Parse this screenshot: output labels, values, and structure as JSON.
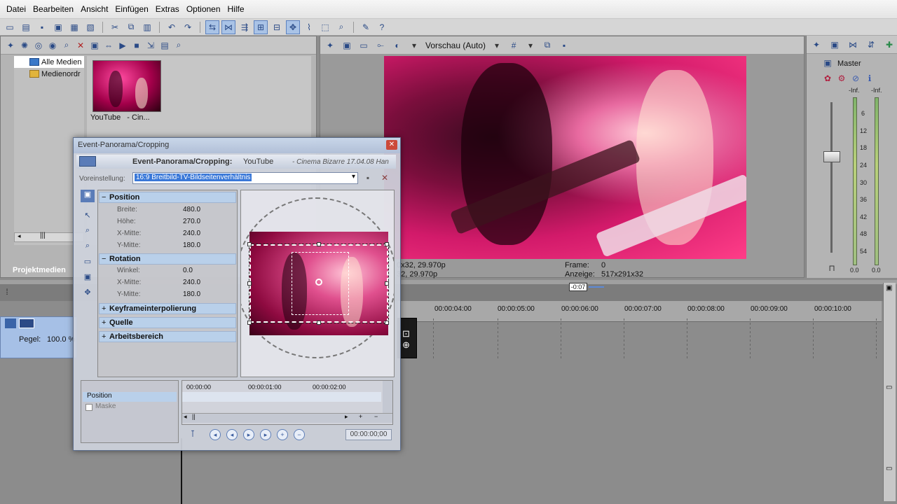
{
  "menubar": [
    "Datei",
    "Bearbeiten",
    "Ansicht",
    "Einfügen",
    "Extras",
    "Optionen",
    "Hilfe"
  ],
  "media": {
    "tree": [
      "Alle Medien",
      "Medienordr"
    ],
    "thumb_label": "YouTube",
    "thumb_sub": "- Cin...",
    "tab_label": "Projektmedien"
  },
  "preview": {
    "quality": "Vorschau (Auto)",
    "info_left1": "0x32, 29.970p",
    "info_left2": "32, 29.970p",
    "frame_label": "Frame:",
    "frame_value": "0",
    "display_label": "Anzeige:",
    "display_value": "517x291x32"
  },
  "mixer": {
    "title": "Master",
    "inf_left": "-Inf.",
    "inf_right": "-Inf.",
    "scale": [
      "6",
      "12",
      "18",
      "24",
      "30",
      "36",
      "42",
      "48",
      "54"
    ],
    "bottom_left": "0.0",
    "bottom_right": "0.0"
  },
  "timeline": {
    "marker": "-0:07",
    "ticks": [
      "00:00:04:00",
      "00:00:05:00",
      "00:00:06:00",
      "00:00:07:00",
      "00:00:08:00",
      "00:00:09:00",
      "00:00:10:00"
    ],
    "track_level_label": "Pegel:",
    "track_level_value": "100.0 %"
  },
  "dialog": {
    "title": "Event-Panorama/Cropping",
    "header_bold": "Event-Panorama/Cropping:",
    "header_media": "YouTube",
    "header_right": "- Cinema Bizarre 17.04.08 Han",
    "preset_label": "Voreinstellung:",
    "preset_value": "16:9 Breitbild-TV-Bildseitenverhältnis",
    "sections": {
      "position": "Position",
      "rotation": "Rotation",
      "keyframe": "Keyframeinterpolierung",
      "source": "Quelle",
      "workspace": "Arbeitsbereich"
    },
    "position_props": [
      {
        "key": "Breite:",
        "value": "480.0"
      },
      {
        "key": "Höhe:",
        "value": "270.0"
      },
      {
        "key": "X-Mitte:",
        "value": "240.0"
      },
      {
        "key": "Y-Mitte:",
        "value": "180.0"
      }
    ],
    "rotation_props": [
      {
        "key": "Winkel:",
        "value": "0.0"
      },
      {
        "key": "X-Mitte:",
        "value": "240.0"
      },
      {
        "key": "Y-Mitte:",
        "value": "180.0"
      }
    ],
    "kf_tracks": [
      "Position",
      "Maske"
    ],
    "kf_ticks": [
      "00:00:00",
      "00:00:01:00",
      "00:00:02:00"
    ],
    "time_display": "00:00:00;00"
  }
}
